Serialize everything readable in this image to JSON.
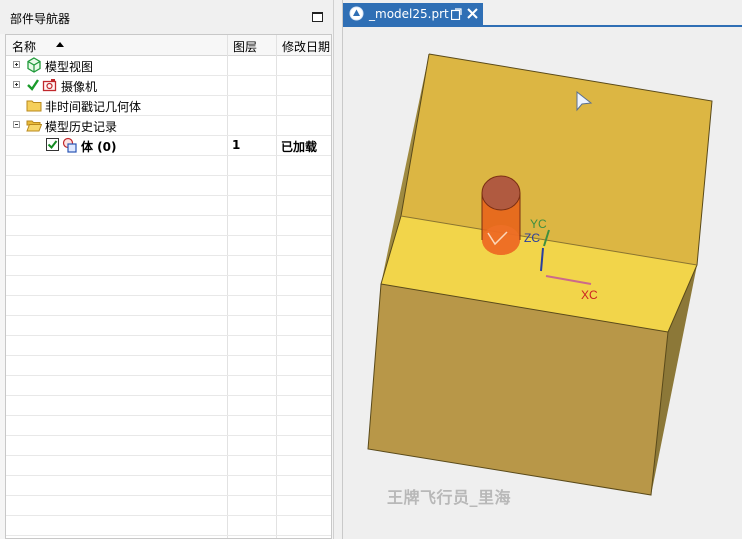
{
  "navigator": {
    "title": "部件导航器",
    "columns": {
      "name": "名称",
      "layer": "图层",
      "modified": "修改日期"
    },
    "items": [
      {
        "label": "模型视图",
        "layer": "",
        "modified": "",
        "icon": "model-views-icon"
      },
      {
        "label": "摄像机",
        "layer": "",
        "modified": "",
        "icon": "camera-icon"
      },
      {
        "label": "非时间戳记几何体",
        "layer": "",
        "modified": "",
        "icon": "folder-icon"
      },
      {
        "label": "模型历史记录",
        "layer": "",
        "modified": "",
        "icon": "folder-open-icon"
      },
      {
        "label": "体 (0)",
        "layer": "1",
        "modified": "已加载",
        "icon": "body-feature-icon"
      }
    ]
  },
  "graphics": {
    "tab_label": "_model25.prt",
    "axes": {
      "x": "XC",
      "y": "YC",
      "z": "ZC"
    },
    "watermark": "王牌飞行员_里海"
  },
  "colors": {
    "accent": "#2f6fb5",
    "block_face": "#e5c040",
    "cylinder": "#ee5a10",
    "axis_x": "#cc2222",
    "axis_y": "#3f8f3f",
    "axis_z": "#2a3f9f"
  }
}
